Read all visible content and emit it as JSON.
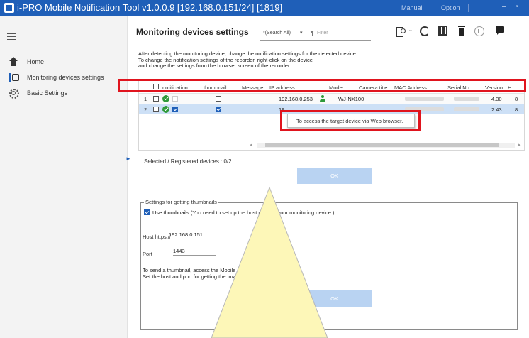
{
  "window": {
    "title": "i-PRO Mobile Notification Tool  v1.0.0.9 [192.168.0.151/24] [1819]",
    "manual_label": "Manual",
    "option_label": "Option",
    "minimize_glyph": "–",
    "maximize_glyph": "▫"
  },
  "sidebar": {
    "items": [
      {
        "label": "Home",
        "icon": "home-icon"
      },
      {
        "label": "Monitoring devices settings",
        "icon": "monitor-devices-icon"
      },
      {
        "label": "Basic Settings",
        "icon": "gear-icon"
      }
    ]
  },
  "header": {
    "title": "Monitoring devices settings",
    "search_select": "*(Search All)",
    "filter_placeholder": "Filter"
  },
  "description": [
    "After detecting the monitoring device, change the notification settings for the detected device.",
    "To change the notification settings of the recorder, right-click on the device",
    "and change the settings from the browser screen of the recorder."
  ],
  "table": {
    "columns": [
      "notification",
      "thumbnail",
      "Message",
      "IP address",
      "Model",
      "Camera title",
      "MAC Address",
      "Serial No.",
      "Version",
      "H"
    ],
    "rows": [
      {
        "num": "1",
        "ip": "192.168.0.253",
        "model": "WJ-NX100",
        "version": "4.30",
        "extra": "8",
        "notification_checked": false,
        "thumbnail_checked": false,
        "selected": false
      },
      {
        "num": "2",
        "ip": "19",
        "model": "",
        "version": "2.43",
        "extra": "8",
        "notification_checked": true,
        "thumbnail_checked": true,
        "selected": true
      }
    ]
  },
  "tooltip": {
    "text": "To access the target device via Web browser."
  },
  "status": {
    "selected_registered": "Selected / Registered devices : 0/2"
  },
  "buttons": {
    "ok_label": "OK"
  },
  "thumbnail_settings": {
    "legend": "Settings for getting thumbnails",
    "use_thumbnails_label": "Use thumbnails (You need to set up the host                   register your monitoring device.)",
    "host_label": "Host https://",
    "host_value": "192.168.0.151",
    "port_label": "Port",
    "port_value": "1443",
    "note": [
      "To send a thumbnail, access the Mobile Noti                       m your mobile device.",
      "Set the host and port for getting the image                        device."
    ]
  },
  "colors": {
    "titlebar": "#1f5fb8",
    "highlight": "#e0141e",
    "selected_row": "#cde0f6",
    "ok_button": "#b9d3f2",
    "status_ok": "#2f9a3a",
    "callout": "#fdf7b8"
  }
}
